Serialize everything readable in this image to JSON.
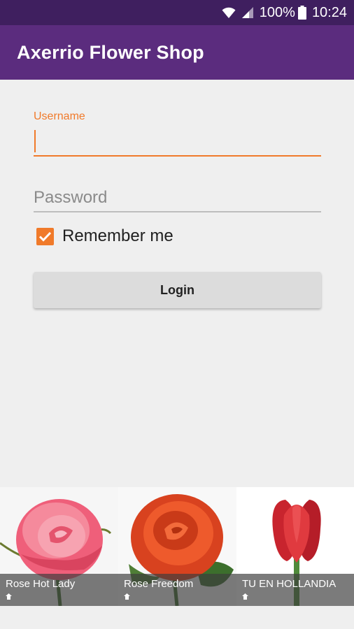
{
  "status_bar": {
    "battery": "100%",
    "time": "10:24",
    "icons": [
      "wifi-icon",
      "signal-icon",
      "battery-icon"
    ]
  },
  "app_bar": {
    "title": "Axerrio Flower Shop",
    "color": "#5b2c7e"
  },
  "login_form": {
    "username_label": "Username",
    "username_value": "",
    "password_placeholder": "Password",
    "password_value": "",
    "remember_label": "Remember me",
    "remember_checked": true,
    "login_button": "Login",
    "accent_color": "#f07a2a"
  },
  "gallery": {
    "items": [
      {
        "name": "Rose Hot Lady",
        "icon": "tag-icon"
      },
      {
        "name": "Rose Freedom",
        "icon": "tag-icon"
      },
      {
        "name": "TU EN HOLLANDIA",
        "icon": "tag-icon"
      }
    ]
  }
}
